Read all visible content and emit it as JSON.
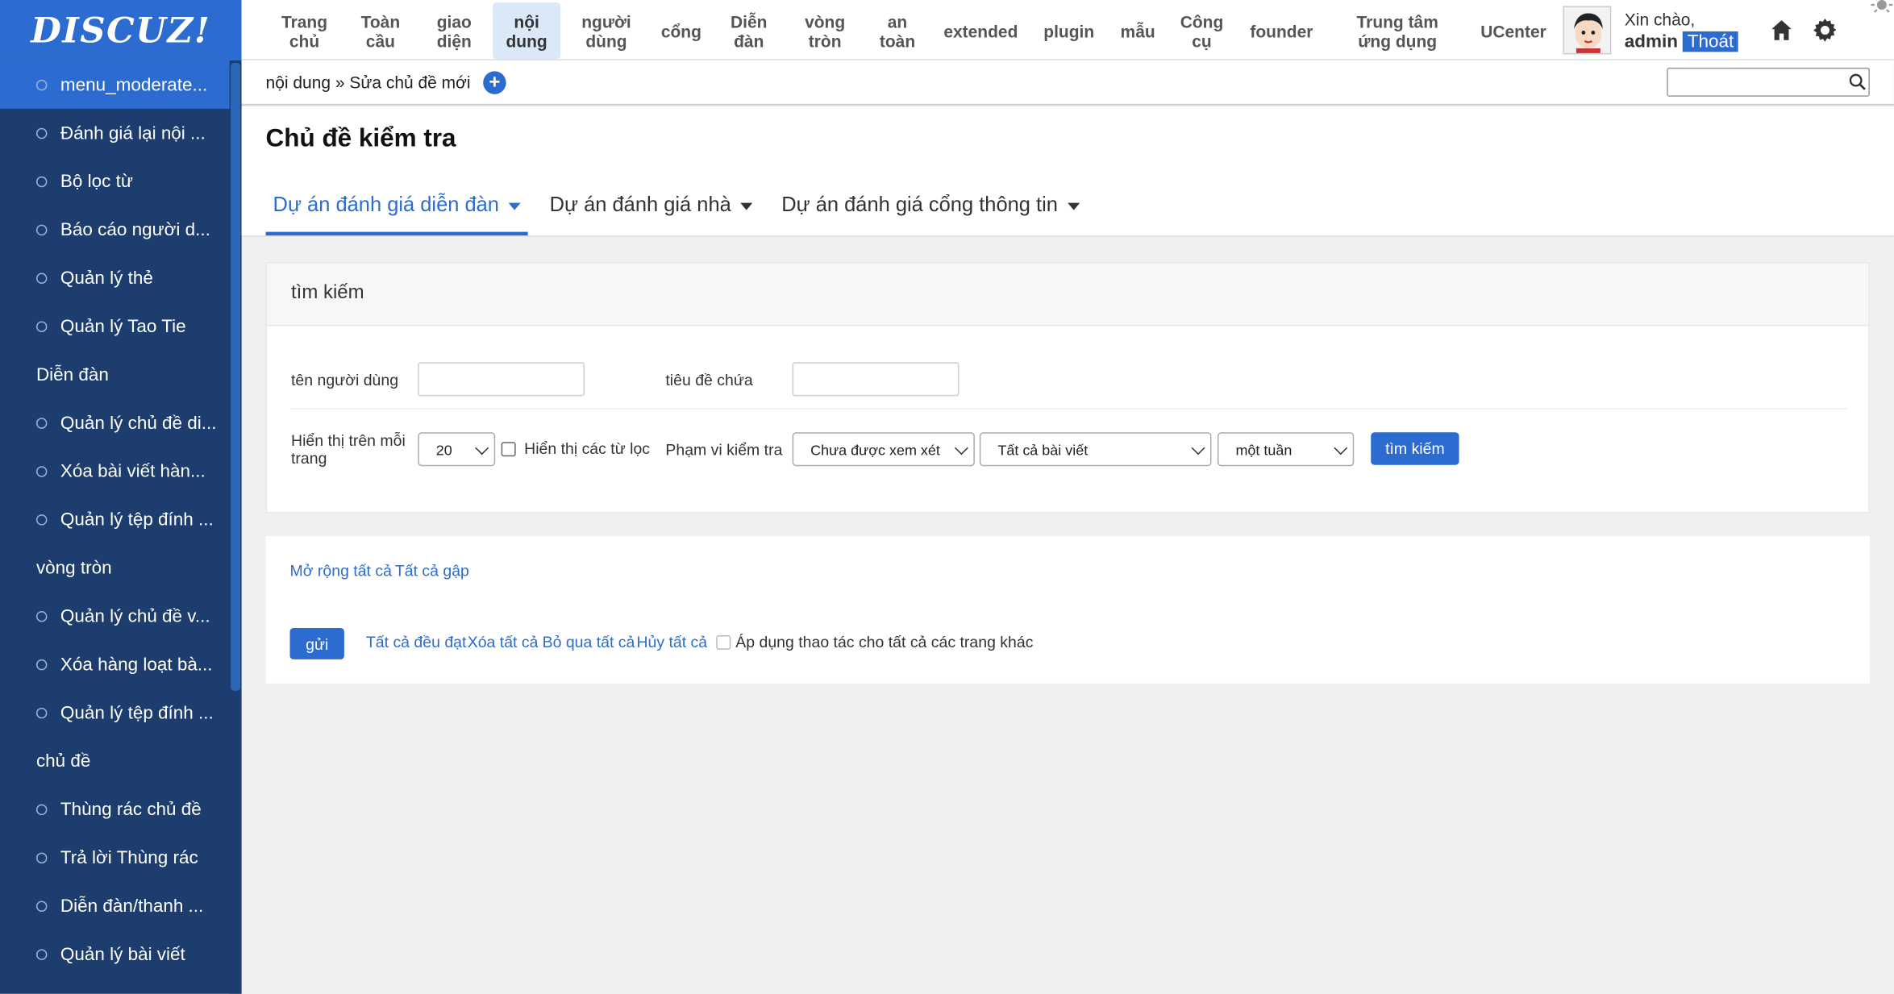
{
  "app": {
    "logo": "DISCUZ!"
  },
  "sidebar": {
    "items": [
      {
        "type": "item",
        "label": "menu_moderate..."
      },
      {
        "type": "item",
        "label": "Đánh giá lại nội ..."
      },
      {
        "type": "item",
        "label": "Bộ lọc từ"
      },
      {
        "type": "item",
        "label": "Báo cáo người d..."
      },
      {
        "type": "item",
        "label": "Quản lý thẻ"
      },
      {
        "type": "item",
        "label": "Quản lý Tao Tie"
      },
      {
        "type": "group",
        "label": "Diễn đàn"
      },
      {
        "type": "item",
        "label": "Quản lý chủ đề di..."
      },
      {
        "type": "item",
        "label": "Xóa bài viết hàn..."
      },
      {
        "type": "item",
        "label": "Quản lý tệp đính ..."
      },
      {
        "type": "group",
        "label": "vòng tròn"
      },
      {
        "type": "item",
        "label": "Quản lý chủ đề v..."
      },
      {
        "type": "item",
        "label": "Xóa hàng loạt bà..."
      },
      {
        "type": "item",
        "label": "Quản lý tệp đính ..."
      },
      {
        "type": "group",
        "label": "chủ đề"
      },
      {
        "type": "item",
        "label": "Thùng rác chủ đề"
      },
      {
        "type": "item",
        "label": "Trả lời Thùng rác"
      },
      {
        "type": "item",
        "label": "Diễn đàn/thanh ..."
      },
      {
        "type": "item",
        "label": "Quản lý bài viết"
      }
    ]
  },
  "topnav": {
    "items": [
      {
        "line1": "Trang",
        "line2": "chủ"
      },
      {
        "line1": "Toàn",
        "line2": "cầu"
      },
      {
        "line1": "giao",
        "line2": "diện"
      },
      {
        "line1": "nội",
        "line2": "dung"
      },
      {
        "line1": "người",
        "line2": "dùng"
      },
      {
        "line1": "cổng",
        "line2": ""
      },
      {
        "line1": "Diễn",
        "line2": "đàn"
      },
      {
        "line1": "vòng",
        "line2": "tròn"
      },
      {
        "line1": "an",
        "line2": "toàn"
      },
      {
        "line1": "extended",
        "line2": ""
      },
      {
        "line1": "plugin",
        "line2": ""
      },
      {
        "line1": "mẫu",
        "line2": ""
      },
      {
        "line1": "Công",
        "line2": "cụ"
      },
      {
        "line1": "founder",
        "line2": ""
      },
      {
        "line1": "Trung tâm",
        "line2": "ứng dụng"
      },
      {
        "line1": "UCenter",
        "line2": ""
      }
    ],
    "active_index": 3,
    "greeting": "Xin chào,",
    "username": "admin",
    "logout": "Thoát"
  },
  "breadcrumb": {
    "text": "nội dung » Sửa chủ đề mới",
    "add_icon": "plus-icon",
    "search_value": ""
  },
  "page": {
    "title": "Chủ đề kiểm tra",
    "tabs": [
      "Dự án đánh giá diễn đàn",
      "Dự án đánh giá nhà",
      "Dự án đánh giá cổng thông tin"
    ]
  },
  "search_panel": {
    "heading": "tìm kiếm",
    "username_label": "tên người dùng",
    "username_value": "",
    "title_label": "tiêu đề chứa",
    "title_value": "",
    "per_page_label": "Hiển thị trên mỗi trang",
    "per_page_value": "20",
    "show_filter_label": "Hiển thị các từ lọc",
    "scope_label": "Phạm vi kiểm tra",
    "status_value": "Chưa được xem xét",
    "posts_value": "Tất cả bài viết",
    "period_value": "một tuần",
    "search_button": "tìm kiếm"
  },
  "action_panel": {
    "expand_all": "Mở rộng tất cả",
    "collapse_all": "Tất cả gập",
    "submit": "gửi",
    "approve_all": "Tất cả đều đạt",
    "delete_all": "Xóa tất cả",
    "ignore_all": "Bỏ qua tất cả",
    "cancel_all": "Hủy tất cả",
    "apply_all_pages": "Áp dụng thao tác cho tất cả các trang khác"
  },
  "colors": {
    "brand": "#2c6cd0",
    "sidebar": "#1c3d6e"
  }
}
